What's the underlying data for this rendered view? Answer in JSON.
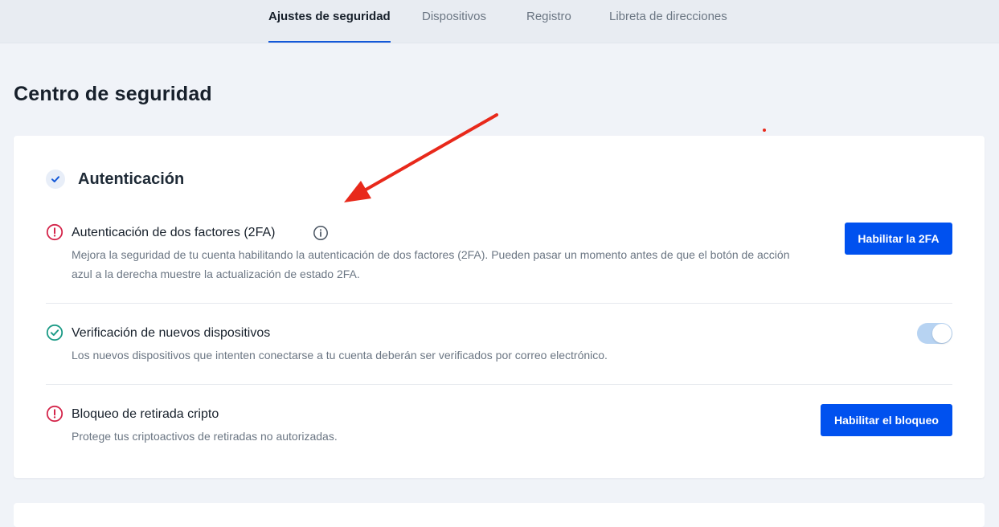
{
  "tabs": [
    {
      "label": "Ajustes de seguridad",
      "active": true
    },
    {
      "label": "Dispositivos",
      "active": false
    },
    {
      "label": "Registro",
      "active": false
    },
    {
      "label": "Libreta de direcciones",
      "active": false
    }
  ],
  "page_title": "Centro de seguridad",
  "section": {
    "title": "Autenticación",
    "icon": "check-icon"
  },
  "items": [
    {
      "title": "Autenticación de dos factores (2FA)",
      "description": "Mejora la seguridad de tu cuenta habilitando la autenticación de dos factores (2FA). Pueden pasar un momento antes de que el botón de acción azul a la derecha muestre la actualización de estado 2FA.",
      "status": "warning",
      "status_icon": "alert-circle-icon",
      "info_icon": "info-icon",
      "action_label": "Habilitar la 2FA"
    },
    {
      "title": "Verificación de nuevos dispositivos",
      "description": "Los nuevos dispositivos que intenten conectarse a tu cuenta deberán ser verificados por correo electrónico.",
      "status": "ok",
      "status_icon": "check-circle-icon",
      "toggle_on": true
    },
    {
      "title": "Bloqueo de retirada cripto",
      "description": "Protege tus criptoactivos de retiradas no autorizadas.",
      "status": "warning",
      "status_icon": "alert-circle-icon",
      "action_label": "Habilitar el bloqueo"
    }
  ],
  "colors": {
    "primary": "#0051ef",
    "warning": "#d4264b",
    "success": "#1a9a85",
    "annotation": "#e8291b",
    "toggle_track": "#b7d3f2"
  }
}
